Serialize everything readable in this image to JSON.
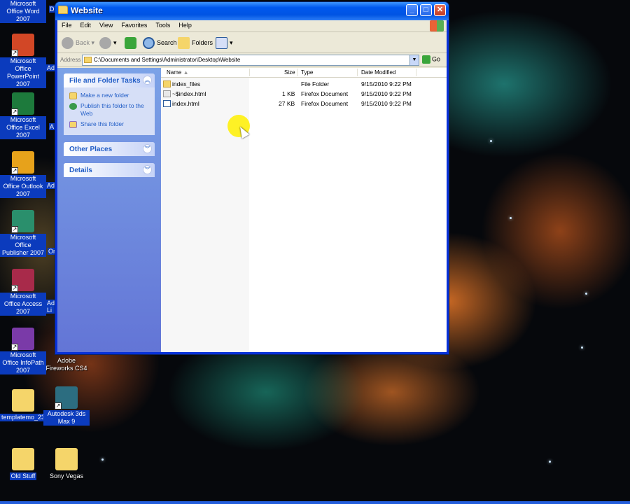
{
  "window": {
    "title": "Website",
    "menu": [
      "File",
      "Edit",
      "View",
      "Favorites",
      "Tools",
      "Help"
    ],
    "toolbar": {
      "back": "Back",
      "search": "Search",
      "folders": "Folders"
    },
    "address": {
      "label": "Address",
      "path": "C:\\Documents and Settings\\Administrator\\Desktop\\Website",
      "go": "Go"
    },
    "tasks": {
      "file_folder_title": "File and Folder Tasks",
      "items": [
        "Make a new folder",
        "Publish this folder to the Web",
        "Share this folder"
      ],
      "other_places": "Other Places",
      "details": "Details"
    },
    "columns": {
      "name": "Name",
      "size": "Size",
      "type": "Type",
      "date": "Date Modified"
    },
    "files": [
      {
        "name": "index_files",
        "size": "",
        "type": "File Folder",
        "date": "9/15/2010 9:22 PM",
        "icon": "folder-icon"
      },
      {
        "name": "~$index.html",
        "size": "1 KB",
        "type": "Firefox Document",
        "date": "9/15/2010 9:22 PM",
        "icon": "document-icon"
      },
      {
        "name": "index.html",
        "size": "27 KB",
        "type": "Firefox Document",
        "date": "9/15/2010 9:22 PM",
        "icon": "html-icon"
      }
    ]
  },
  "desktop": {
    "icons": [
      {
        "label": "Microsoft Office Word 2007"
      },
      {
        "label": "Microsoft Office PowerPoint 2007"
      },
      {
        "label": "Microsoft Office Excel 2007"
      },
      {
        "label": "Microsoft Office Outlook 2007"
      },
      {
        "label": "Microsoft Office Publisher 2007"
      },
      {
        "label": "Microsoft Office Access 2007"
      },
      {
        "label": "Microsoft Office InfoPath 2007"
      },
      {
        "label": "Adobe Fireworks CS4"
      },
      {
        "label": "templatemo_23..."
      },
      {
        "label": "Autodesk 3ds Max 9"
      },
      {
        "label": "Old Stuff"
      },
      {
        "label": "Sony Vegas"
      }
    ],
    "truncated": [
      "D",
      "Adc",
      "A",
      "Adc",
      "Or",
      "Ad Li"
    ]
  }
}
